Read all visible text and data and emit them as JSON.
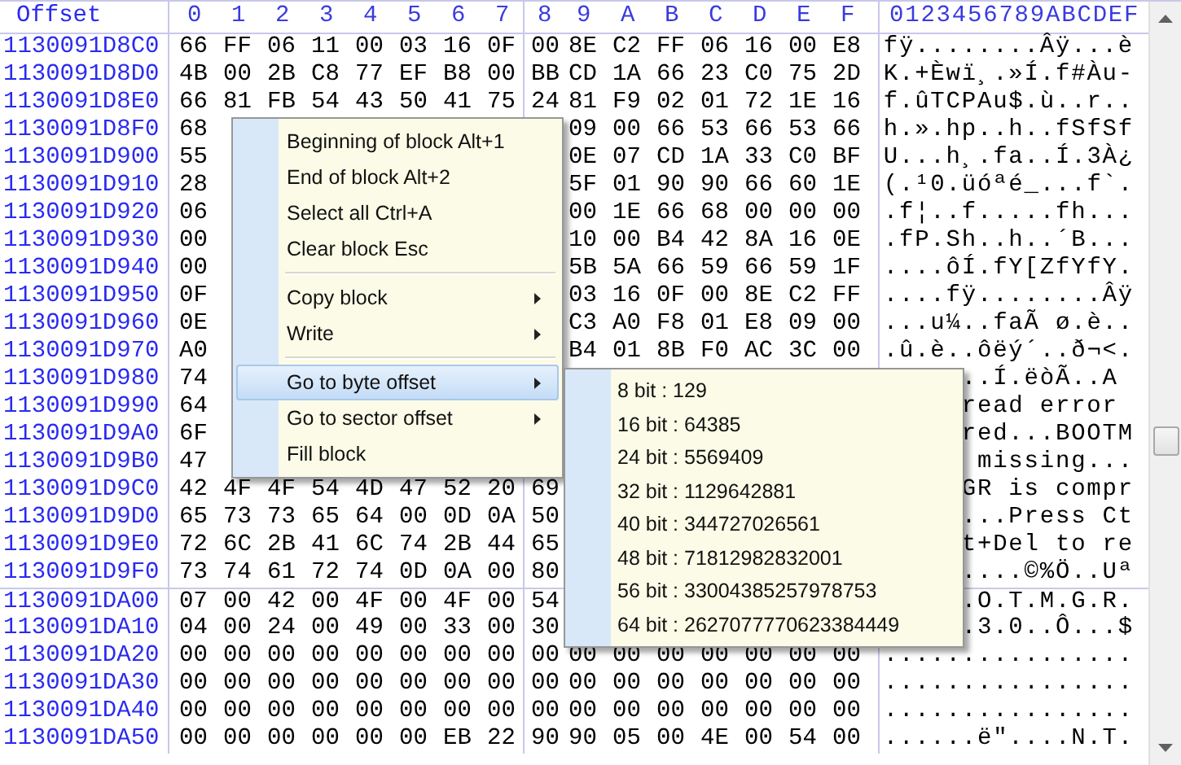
{
  "header": {
    "offset": "Offset",
    "columns": [
      "0",
      "1",
      "2",
      "3",
      "4",
      "5",
      "6",
      "7",
      "8",
      "9",
      "A",
      "B",
      "C",
      "D",
      "E",
      "F"
    ],
    "ascii": "0123456789ABCDEF"
  },
  "rows": [
    {
      "offset": "1130091D8C0",
      "hex_start": [
        "66",
        "FF",
        "06",
        "11",
        "00",
        "03",
        "16",
        "0F",
        "00",
        "8E",
        "C2",
        "FF",
        "06",
        "16",
        "00",
        "E8"
      ],
      "ascii": "fÿ........Âÿ...è",
      "sector_start": false
    },
    {
      "offset": "1130091D8D0",
      "hex_start": [
        "4B",
        "00",
        "2B",
        "C8",
        "77",
        "EF",
        "B8",
        "00",
        "BB",
        "CD",
        "1A",
        "66",
        "23",
        "C0",
        "75",
        "2D"
      ],
      "ascii": "K.+Èwï¸.»Í.f#Àu-",
      "sector_start": false
    },
    {
      "offset": "1130091D8E0",
      "hex_start": [
        "66",
        "81",
        "FB",
        "54",
        "43",
        "50",
        "41",
        "75",
        "24",
        "81",
        "F9",
        "02",
        "01",
        "72",
        "1E",
        "16"
      ],
      "ascii": "f.ûTCPAu$.ù..r..",
      "sector_start": false
    },
    {
      "offset": "1130091D8F0",
      "hex_start": [
        "68"
      ],
      "hex_end": [
        "09",
        "00",
        "66",
        "53",
        "66",
        "53",
        "66"
      ],
      "ascii": "h.».hp..h..fSfSf",
      "sector_start": false
    },
    {
      "offset": "1130091D900",
      "hex_start": [
        "55"
      ],
      "hex_end": [
        "0E",
        "07",
        "CD",
        "1A",
        "33",
        "C0",
        "BF"
      ],
      "ascii": "U...h¸.fa..Í.3À¿",
      "sector_start": false
    },
    {
      "offset": "1130091D910",
      "hex_start": [
        "28"
      ],
      "hex_end": [
        "5F",
        "01",
        "90",
        "90",
        "66",
        "60",
        "1E"
      ],
      "ascii": "(.¹0.üóªé_...f`.",
      "sector_start": false
    },
    {
      "offset": "1130091D920",
      "hex_start": [
        "06"
      ],
      "hex_end": [
        "00",
        "1E",
        "66",
        "68",
        "00",
        "00",
        "00"
      ],
      "ascii": ".f¦..f.....fh...",
      "sector_start": false
    },
    {
      "offset": "1130091D930",
      "hex_start": [
        "00"
      ],
      "hex_end": [
        "10",
        "00",
        "B4",
        "42",
        "8A",
        "16",
        "0E"
      ],
      "ascii": ".fP.Sh..h..´B...",
      "sector_start": false
    },
    {
      "offset": "1130091D940",
      "hex_start": [
        "00"
      ],
      "hex_end": [
        "5B",
        "5A",
        "66",
        "59",
        "66",
        "59",
        "1F"
      ],
      "ascii": "....ôÍ.fY[ZfYfY.",
      "sector_start": false
    },
    {
      "offset": "1130091D950",
      "hex_start": [
        "0F"
      ],
      "hex_end": [
        "03",
        "16",
        "0F",
        "00",
        "8E",
        "C2",
        "FF"
      ],
      "ascii": "....fÿ........Âÿ",
      "sector_start": false
    },
    {
      "offset": "1130091D960",
      "hex_start": [
        "0E"
      ],
      "hex_end": [
        "C3",
        "A0",
        "F8",
        "01",
        "E8",
        "09",
        "00"
      ],
      "ascii": "...u¼..faÃ ø.è..",
      "sector_start": false
    },
    {
      "offset": "1130091D970",
      "hex_start": [
        "A0"
      ],
      "hex_end": [
        "B4",
        "01",
        "8B",
        "F0",
        "AC",
        "3C",
        "00"
      ],
      "ascii": ".û.è..ôëý´..ð¬<.",
      "sector_start": false
    },
    {
      "offset": "1130091D980",
      "hex_start": [
        "74"
      ],
      "ascii": "..Í.ëòÃ..A ",
      "sector_start": false
    },
    {
      "offset": "1130091D990",
      "hex_start": [
        "64"
      ],
      "ascii": "read error ",
      "sector_start": false
    },
    {
      "offset": "1130091D9A0",
      "hex_start": [
        "6F"
      ],
      "ascii": "red...BOOTM",
      "sector_start": false
    },
    {
      "offset": "1130091D9B0",
      "hex_start": [
        "47"
      ],
      "ascii": " missing...",
      "sector_start": false
    },
    {
      "offset": "1130091D9C0",
      "hex_start": [
        "42",
        "4F",
        "4F",
        "54",
        "4D",
        "47",
        "52",
        "20",
        "69"
      ],
      "ascii": "GR is compr",
      "sector_start": false
    },
    {
      "offset": "1130091D9D0",
      "hex_start": [
        "65",
        "73",
        "73",
        "65",
        "64",
        "00",
        "0D",
        "0A",
        "50"
      ],
      "ascii": "...Press Ct",
      "sector_start": false
    },
    {
      "offset": "1130091D9E0",
      "hex_start": [
        "72",
        "6C",
        "2B",
        "41",
        "6C",
        "74",
        "2B",
        "44",
        "65"
      ],
      "ascii": "t+Del to re",
      "sector_start": false
    },
    {
      "offset": "1130091D9F0",
      "hex_start": [
        "73",
        "74",
        "61",
        "72",
        "74",
        "0D",
        "0A",
        "00",
        "80"
      ],
      "ascii": "....©%Ö..Uª",
      "sector_start": false
    },
    {
      "offset": "1130091DA00",
      "hex_start": [
        "07",
        "00",
        "42",
        "00",
        "4F",
        "00",
        "4F",
        "00",
        "54"
      ],
      "ascii": ".O.T.M.G.R.",
      "sector_start": true
    },
    {
      "offset": "1130091DA10",
      "hex_start": [
        "04",
        "00",
        "24",
        "00",
        "49",
        "00",
        "33",
        "00",
        "30"
      ],
      "ascii": ".3.0..Ô...$",
      "sector_start": false
    },
    {
      "offset": "1130091DA20",
      "hex_start": [
        "00",
        "00",
        "00",
        "00",
        "00",
        "00",
        "00",
        "00",
        "00",
        "00",
        "00",
        "00",
        "00",
        "00",
        "00",
        "00"
      ],
      "ascii": "................",
      "sector_start": false
    },
    {
      "offset": "1130091DA30",
      "hex_start": [
        "00",
        "00",
        "00",
        "00",
        "00",
        "00",
        "00",
        "00",
        "00",
        "00",
        "00",
        "00",
        "00",
        "00",
        "00",
        "00"
      ],
      "ascii": "................",
      "sector_start": false
    },
    {
      "offset": "1130091DA40",
      "hex_start": [
        "00",
        "00",
        "00",
        "00",
        "00",
        "00",
        "00",
        "00",
        "00",
        "00",
        "00",
        "00",
        "00",
        "00",
        "00",
        "00"
      ],
      "ascii": "................",
      "sector_start": false
    },
    {
      "offset": "1130091DA50",
      "hex_start": [
        "00",
        "00",
        "00",
        "00",
        "00",
        "00",
        "EB",
        "22",
        "90",
        "90",
        "05",
        "00",
        "4E",
        "00",
        "54",
        "00"
      ],
      "ascii": "......ë\"....N.T.",
      "sector_start": false
    }
  ],
  "context_menu": {
    "items": [
      {
        "kind": "item",
        "label": "Beginning of block Alt+1",
        "has_submenu": false,
        "selected": false
      },
      {
        "kind": "item",
        "label": "End of block Alt+2",
        "has_submenu": false,
        "selected": false
      },
      {
        "kind": "item",
        "label": "Select all Ctrl+A",
        "has_submenu": false,
        "selected": false
      },
      {
        "kind": "item",
        "label": "Clear block Esc",
        "has_submenu": false,
        "selected": false
      },
      {
        "kind": "separator"
      },
      {
        "kind": "item",
        "label": "Copy block",
        "has_submenu": true,
        "selected": false
      },
      {
        "kind": "item",
        "label": "Write",
        "has_submenu": true,
        "selected": false
      },
      {
        "kind": "separator"
      },
      {
        "kind": "item",
        "label": "Go to byte offset",
        "has_submenu": true,
        "selected": true
      },
      {
        "kind": "item",
        "label": "Go to sector offset",
        "has_submenu": true,
        "selected": false
      },
      {
        "kind": "item",
        "label": "Fill block",
        "has_submenu": false,
        "selected": false
      }
    ]
  },
  "submenu": {
    "items": [
      "8 bit : 129",
      "16 bit : 64385",
      "24 bit : 5569409",
      "32 bit : 1129642881",
      "40 bit : 344727026561",
      "48 bit : 71812982832001",
      "56 bit : 33004385257978753",
      "64 bit : 2627077770623384449"
    ]
  }
}
